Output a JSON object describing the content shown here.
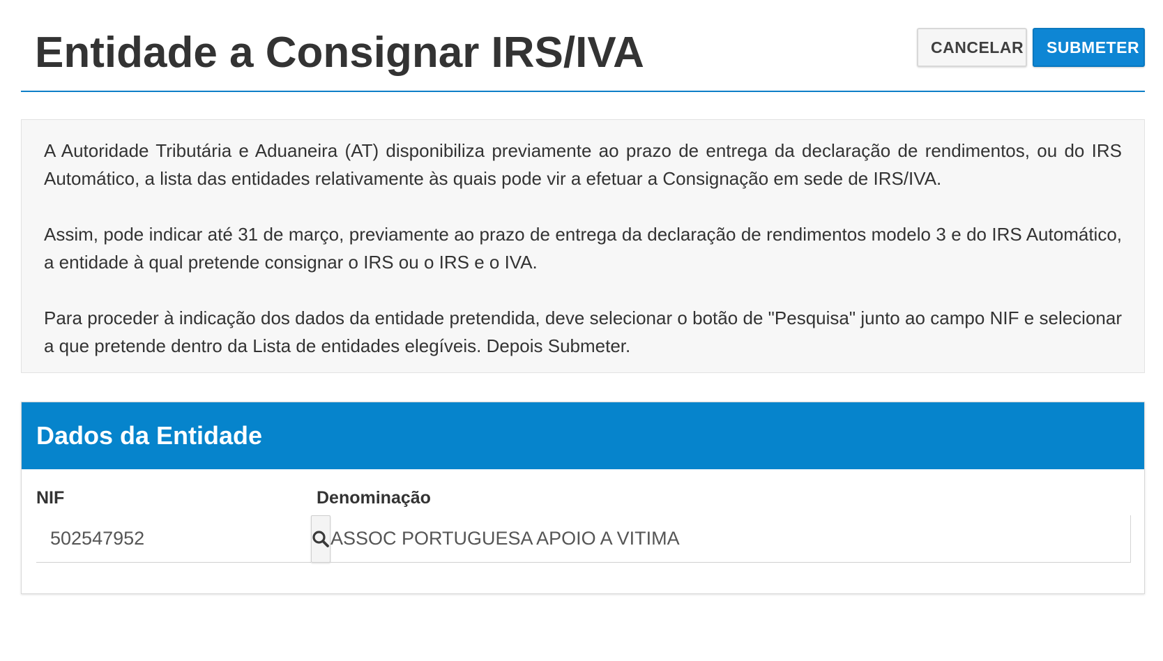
{
  "header": {
    "title": "Entidade a Consignar IRS/IVA",
    "cancel_label": "CANCELAR",
    "submit_label": "SUBMETER"
  },
  "info": {
    "paragraphs": [
      "A Autoridade Tributária e Aduaneira (AT) disponibiliza previamente ao prazo de entrega da declaração de rendimentos, ou do IRS Automático, a lista das entidades relativamente às quais pode vir a efetuar a Consignação em sede de IRS/IVA.",
      "Assim, pode indicar até 31 de março, previamente ao prazo de entrega da declaração de rendimentos modelo 3 e do IRS Automático, a entidade à qual pretende consignar o IRS ou o IRS e o IVA.",
      "Para proceder à indicação dos dados da entidade pretendida, deve selecionar o botão de \"Pesquisa\" junto ao campo NIF e selecionar a que pretende dentro da Lista de entidades elegíveis. Depois Submeter."
    ]
  },
  "panel": {
    "title": "Dados da Entidade",
    "nif": {
      "label": "NIF",
      "value": "502547952",
      "search_icon": "search-icon"
    },
    "denominacao": {
      "label": "Denominação",
      "value": "ASSOC PORTUGUESA APOIO A VITIMA"
    }
  },
  "colors": {
    "accent": "#0684cc",
    "submit_button": "#0e86d4",
    "info_background": "#f7f7f7"
  }
}
